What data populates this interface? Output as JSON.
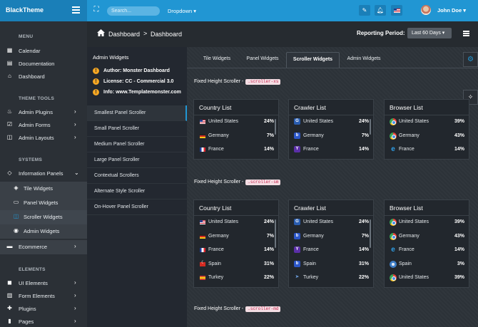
{
  "app": {
    "brand": "BlackTheme"
  },
  "topbar": {
    "search_placeholder": "Search...",
    "dropdown_label": "Dropdown",
    "user_name": "John Doe"
  },
  "sidebar": {
    "sections": {
      "menu": "MENU",
      "theme_tools": "THEME TOOLS",
      "systems": "SYSTEMS",
      "elements": "ELEMENTS"
    },
    "items": {
      "calendar": "Calendar",
      "documentation": "Documentation",
      "dashboard": "Dashboard",
      "admin_plugins": "Admin Plugins",
      "admin_forms": "Admin Forms",
      "admin_layouts": "Admin Layouts",
      "information_panels": "Information Panels",
      "tile_widgets": "Tile Widgets",
      "panel_widgets": "Panel Widgets",
      "scroller_widgets": "Scroller Widgets",
      "admin_widgets": "Admin Widgets",
      "ecommerce": "Ecommerce",
      "ui_elements": "UI Elements",
      "form_elements": "Form Elements",
      "plugins": "Plugins",
      "pages": "Pages"
    }
  },
  "breadcrumb": {
    "home": "Dashboard",
    "current": "Dashboard",
    "separator": ">"
  },
  "reporting": {
    "label": "Reporting Period:",
    "value": "Last 60 Days"
  },
  "subpanel": {
    "title": "Admin Widgets",
    "info": [
      "Author: Monster Dashboard",
      "License: CC - Commercial 3.0",
      "Info: www.Templatemonster.com"
    ],
    "list": [
      "Smallest Panel Scroller",
      "Small Panel Scroller",
      "Medium Panel Scroller",
      "Large Panel Scroller",
      "Contextual Scrollers",
      "Alternate Style Scroller",
      "On-Hover Panel Scroller"
    ]
  },
  "tabs": [
    "Tile Widgets",
    "Panel Widgets",
    "Scroller Widgets",
    "Admin Widgets"
  ],
  "sections": {
    "xs": {
      "title": "Fixed Height Scroller -",
      "code": ".scroller-xs"
    },
    "sm": {
      "title": "Fixed Height Scroller -",
      "code": ".scroller-sm"
    },
    "md": {
      "title": "Fixed Height Scroller -",
      "code": ".scroller-md"
    }
  },
  "cards": {
    "country_list": {
      "title": "Country List",
      "rows": [
        {
          "name": "United States",
          "pct": "24%"
        },
        {
          "name": "Germany",
          "pct": "7%"
        },
        {
          "name": "France",
          "pct": "14%"
        },
        {
          "name": "Spain",
          "pct": "31%"
        },
        {
          "name": "Turkey",
          "pct": "22%"
        }
      ]
    },
    "crawler_list": {
      "title": "Crawler List",
      "rows": [
        {
          "name": "United States",
          "pct": "24%"
        },
        {
          "name": "Germany",
          "pct": "7%"
        },
        {
          "name": "France",
          "pct": "14%"
        },
        {
          "name": "Spain",
          "pct": "31%"
        },
        {
          "name": "Turkey",
          "pct": "22%"
        }
      ]
    },
    "browser_list": {
      "title": "Browser List",
      "rows": [
        {
          "name": "United States",
          "pct": "39%"
        },
        {
          "name": "Germany",
          "pct": "43%"
        },
        {
          "name": "France",
          "pct": "14%"
        },
        {
          "name": "Spain",
          "pct": "3%"
        },
        {
          "name": "United States",
          "pct": "39%"
        }
      ]
    }
  },
  "colors": {
    "accent": "#2196d3",
    "background": "#2b3036",
    "code_text": "#c7254e"
  }
}
